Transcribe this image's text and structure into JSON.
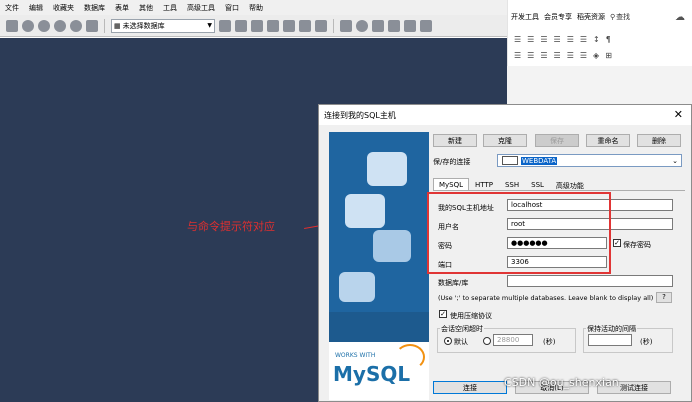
{
  "app": {
    "menu": [
      "文件",
      "编辑",
      "收藏夹",
      "数据库",
      "表单",
      "其他",
      "工具",
      "高级工具",
      "窗口",
      "帮助"
    ],
    "db_placeholder": "未选择数据库"
  },
  "word": {
    "tabs": [
      "开发工具",
      "会员专享",
      "稻壳资源"
    ],
    "search_label": "查找"
  },
  "annotation": {
    "text": "与命令提示符对应"
  },
  "dialog": {
    "title": "连接到我的SQL主机",
    "close": "✕",
    "buttons": {
      "new": "新建",
      "clone": "克隆",
      "save": "保存",
      "rename": "重命名",
      "delete": "删除"
    },
    "saved_conn_label": "保/存的连接",
    "saved_conn_value": "WEBDATA",
    "tabs": [
      "MySQL",
      "HTTP",
      "SSH",
      "SSL",
      "高级功能"
    ],
    "fields": {
      "host_label": "我的SQL主机地址",
      "host_value": "localhost",
      "user_label": "用户名",
      "user_value": "root",
      "pass_label": "密码",
      "pass_value": "●●●●●●",
      "save_pass_label": "保存密码",
      "port_label": "端口",
      "port_value": "3306",
      "db_label": "数据库/库",
      "db_value": "",
      "db_hint": "(Use ';' to separate multiple databases. Leave blank to display all)",
      "db_hint_btn": "?",
      "compress_label": "使用压缩协议",
      "session_timeout_label": "会话空闲超时",
      "default_label": "默认",
      "timeout_value": "28800",
      "seconds1": "(秒)",
      "keepalive_label": "保持活动的间隔",
      "keepalive_value": "",
      "seconds2": "(秒)"
    },
    "footer": {
      "connect": "连接",
      "cancel": "取消(L)",
      "test": "测试连接"
    },
    "logo": {
      "works_with": "WORKS WITH",
      "brand": "MySQL"
    }
  },
  "watermark": "CSDN @ou_shenxian"
}
